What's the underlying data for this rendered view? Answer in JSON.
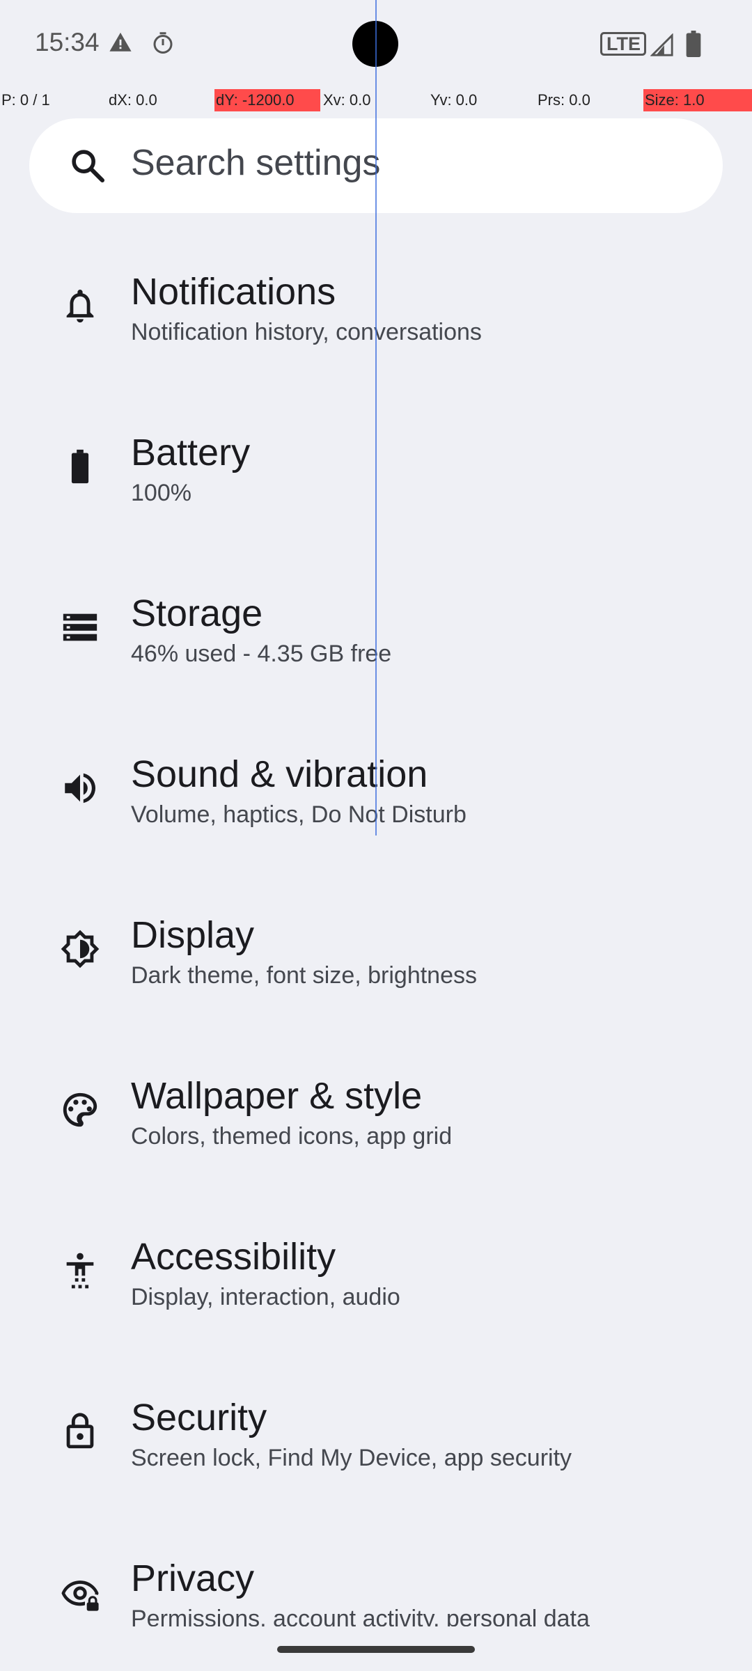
{
  "status_bar": {
    "time": "15:34",
    "network": "LTE",
    "icons": [
      "warning-icon",
      "timer-icon",
      "lte-icon",
      "signal-icon",
      "battery-icon"
    ]
  },
  "pointer_overlay": {
    "p": "P: 0 / 1",
    "dx": "dX: 0.0",
    "dy": "dY: -1200.0",
    "xv": "Xv: 0.0",
    "yv": "Yv: 0.0",
    "prs": "Prs: 0.0",
    "size": "Size: 1.0"
  },
  "search": {
    "placeholder": "Search settings",
    "icon": "search-icon"
  },
  "settings": [
    {
      "icon": "bell-icon",
      "title": "Notifications",
      "summary": "Notification history, conversations"
    },
    {
      "icon": "battery-icon",
      "title": "Battery",
      "summary": "100%"
    },
    {
      "icon": "storage-icon",
      "title": "Storage",
      "summary": "46% used - 4.35 GB free"
    },
    {
      "icon": "volume-icon",
      "title": "Sound & vibration",
      "summary": "Volume, haptics, Do Not Disturb"
    },
    {
      "icon": "brightness-icon",
      "title": "Display",
      "summary": "Dark theme, font size, brightness"
    },
    {
      "icon": "palette-icon",
      "title": "Wallpaper & style",
      "summary": "Colors, themed icons, app grid"
    },
    {
      "icon": "accessibility-icon",
      "title": "Accessibility",
      "summary": "Display, interaction, audio"
    },
    {
      "icon": "lock-icon",
      "title": "Security",
      "summary": "Screen lock, Find My Device, app security"
    },
    {
      "icon": "privacy-eye-icon",
      "title": "Privacy",
      "summary": "Permissions, account activity, personal data"
    }
  ],
  "colors": {
    "background": "#eff0f5",
    "title_text": "#1b1b1f",
    "summary_text": "#44474e",
    "overlay_red": "#ff4b4b"
  }
}
